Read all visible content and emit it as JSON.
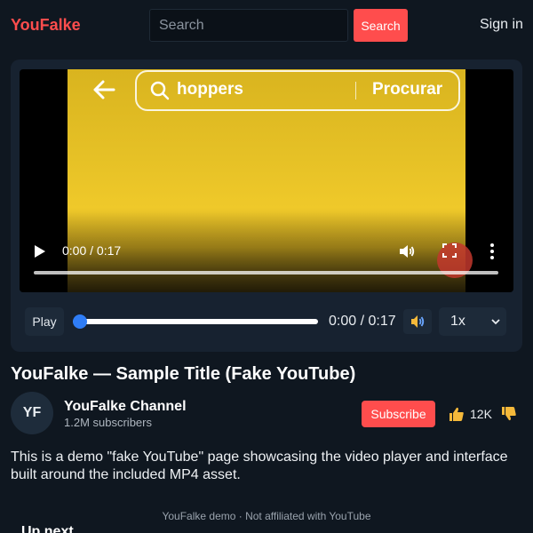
{
  "header": {
    "logo": "YouFalke",
    "search_placeholder": "Search",
    "search_button": "Search",
    "sign_in": "Sign in"
  },
  "video_frame": {
    "search_text": "hoppers",
    "search_action": "Procurar"
  },
  "native_controls": {
    "time": "0:00 / 0:17",
    "progress": 0.0
  },
  "custom_controls": {
    "play_label": "Play",
    "time": "0:00 / 0:17",
    "progress": 0.0,
    "speed": "1x"
  },
  "video": {
    "title": "YouFalke — Sample Title (Fake YouTube)"
  },
  "channel": {
    "initials": "YF",
    "name": "YouFalke Channel",
    "subscribers": "1.2M subscribers",
    "subscribe_label": "Subscribe",
    "likes": "12K"
  },
  "description": "This is a demo \"fake YouTube\" page showcasing the video player and interface built around the included MP4 asset.",
  "footer": {
    "note": "YouFalke demo · Not affiliated with YouTube",
    "up_next": "Up next"
  },
  "colors": {
    "accent": "#ff4d4d",
    "background": "#0f1720",
    "slider": "#2f7df6"
  },
  "icons": [
    "back-arrow-icon",
    "search-icon",
    "play-icon",
    "volume-icon",
    "fullscreen-icon",
    "more-vert-icon",
    "chevron-down-icon",
    "thumbs-up-icon",
    "thumbs-down-icon",
    "speaker-icon"
  ]
}
